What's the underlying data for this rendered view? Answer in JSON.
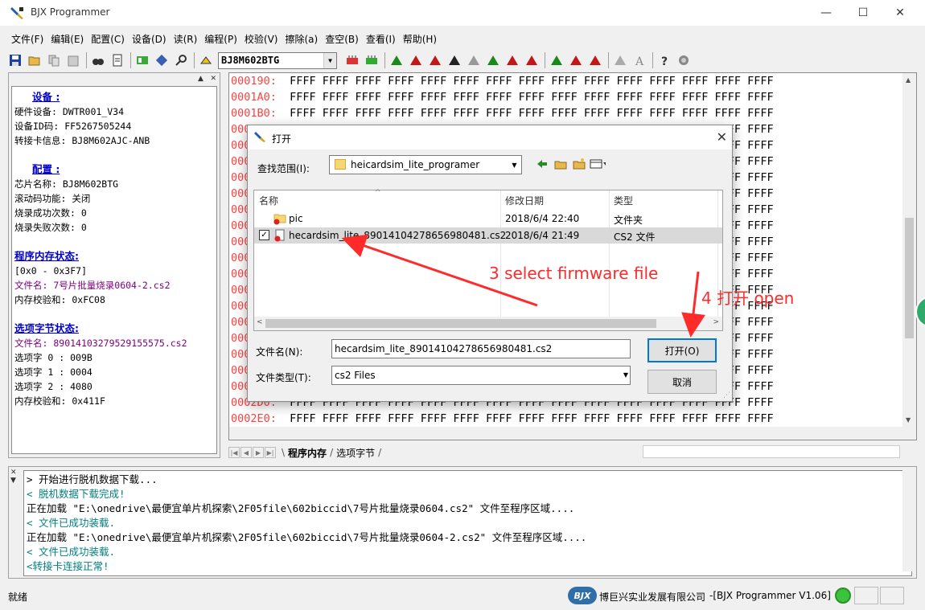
{
  "window": {
    "title": "BJX Programmer",
    "controls": {
      "minimize": "—",
      "maximize": "☐",
      "close": "✕"
    }
  },
  "menu": [
    "文件(F)",
    "编辑(E)",
    "配置(C)",
    "设备(D)",
    "读(R)",
    "编程(P)",
    "校验(V)",
    "擦除(a)",
    "查空(B)",
    "查看(I)",
    "帮助(H)"
  ],
  "toolbar": {
    "chip": "BJ8M602BTG"
  },
  "left_panel": {
    "device_section": "设备    :",
    "device_lines": [
      "硬件设备: DWTR001_V34",
      "设备ID码: FF5267505244",
      "转接卡信息: BJ8M602AJC-ANB"
    ],
    "config_section": "配置    :",
    "config_lines": [
      "芯片名称: BJ8M602BTG",
      "滚动码功能: 关闭",
      "烧录成功次数: 0",
      "烧录失败次数: 0"
    ],
    "memory_section": "程序内存状态:",
    "memory_range": "[0x0 - 0x3F7]",
    "memory_file": "文件名: 7号片批量烧录0604-2.cs2",
    "memory_checksum": "内存校验和: 0xFC08",
    "option_section": "选项字节状态:",
    "option_file": "文件名: 89014103279529155575.cs2",
    "option_lines": [
      "选项字 0 : 009B",
      "选项字 1 : 0004",
      "选项字 2 : 4080",
      "内存校验和: 0x411F"
    ]
  },
  "hex": {
    "rows": [
      {
        "addr": "000190:",
        "data": "FFFF FFFF FFFF FFFF FFFF FFFF FFFF FFFF FFFF FFFF FFFF FFFF FFFF FFFF FFFF"
      },
      {
        "addr": "0001A0:",
        "data": "FFFF FFFF FFFF FFFF FFFF FFFF FFFF FFFF FFFF FFFF FFFF FFFF FFFF FFFF FFFF"
      },
      {
        "addr": "0001B0:",
        "data": "FFFF FFFF FFFF FFFF FFFF FFFF FFFF FFFF FFFF FFFF FFFF FFFF FFFF FFFF FFFF"
      },
      {
        "addr": "0001C0:",
        "data": "FFFF FFFF FFFF FFFF FFFF FFFF FFFF FFFF FFFF FFFF FFFF FFFF FFFF FFFF FFFF"
      },
      {
        "addr": "0001D0:",
        "data": "FFFF FFFF FFFF FFFF FFFF FFFF FFFF FFFF FFFF FFFF FFFF FFFF FFFF FFFF FFFF"
      },
      {
        "addr": "0001E0:",
        "data": "FFFF FFFF FFFF FFFF FFFF FFFF FFFF FFFF FFFF FFFF FFFF FFFF FFFF FFFF FFFF"
      },
      {
        "addr": "0001F0:",
        "data": "FFFF FFFF FFFF FFFF FFFF FFFF FFFF FFFF FFFF FFFF FFFF FFFF FFFF FFFF FFFF"
      },
      {
        "addr": "000200:",
        "data": "FFFF FFFF FFFF FFFF FFFF FFFF FFFF FFFF FFFF FFFF FFFF FFFF FFFF FFFF FFFF"
      },
      {
        "addr": "000210:",
        "data": "FFFF FFFF FFFF FFFF FFFF FFFF FFFF FFFF FFFF FFFF FFFF FFFF FFFF FFFF FFFF"
      },
      {
        "addr": "000220:",
        "data": "FFFF FFFF FFFF FFFF FFFF FFFF FFFF FFFF FFFF FFFF FFFF FFFF FFFF FFFF FFFF"
      },
      {
        "addr": "000230:",
        "data": "FFFF FFFF FFFF FFFF FFFF FFFF FFFF FFFF FFFF FFFF FFFF FFFF FFFF FFFF FFFF"
      },
      {
        "addr": "000240:",
        "data": "FFFF FFFF FFFF FFFF FFFF FFFF FFFF FFFF FFFF FFFF FFFF FFFF FFFF FFFF FFFF"
      },
      {
        "addr": "000250:",
        "data": "FFFF FFFF FFFF FFFF FFFF FFFF FFFF FFFF FFFF FFFF FFFF FFFF FFFF FFFF FFFF"
      },
      {
        "addr": "000260:",
        "data": "FFFF FFFF FFFF FFFF FFFF FFFF FFFF FFFF FFFF FFFF FFFF FFFF FFFF FFFF FFFF"
      },
      {
        "addr": "000270:",
        "data": "FFFF FFFF FFFF FFFF FFFF FFFF FFFF FFFF FFFF FFFF FFFF FFFF FFFF FFFF FFFF"
      },
      {
        "addr": "000280:",
        "data": "FFFF FFFF FFFF FFFF FFFF FFFF FFFF FFFF FFFF FFFF FFFF FFFF FFFF FFFF FFFF"
      },
      {
        "addr": "000290:",
        "data": "FFFF FFFF FFFF FFFF FFFF FFFF FFFF FFFF FFFF FFFF FFFF FFFF FFFF FFFF FFFF"
      },
      {
        "addr": "0002A0:",
        "data": "FFFF FFFF FFFF FFFF FFFF FFFF FFFF FFFF FFFF FFFF FFFF FFFF FFFF FFFF FFFF"
      },
      {
        "addr": "0002B0:",
        "data": "FFFF FFFF FFFF FFFF FFFF FFFF FFFF FFFF FFFF FFFF FFFF FFFF FFFF FFFF FFFF"
      },
      {
        "addr": "0002C0:",
        "data": "FFFF FFFF FFFF FFFF FFFF FFFF FFFF FFFF FFFF FFFF FFFF FFFF FFFF FFFF FFFF"
      },
      {
        "addr": "0002D0:",
        "data": "FFFF FFFF FFFF FFFF FFFF FFFF FFFF FFFF FFFF FFFF FFFF FFFF FFFF FFFF FFFF"
      },
      {
        "addr": "0002E0:",
        "data": "FFFF FFFF FFFF FFFF FFFF FFFF FFFF FFFF FFFF FFFF FFFF FFFF FFFF FFFF FFFF"
      }
    ]
  },
  "sheet_tabs": [
    "程序内存",
    "选项字节"
  ],
  "log": [
    {
      "text": "> 开始进行脱机数据下载...",
      "kind": "normal"
    },
    {
      "text": "< 脱机数据下载完成!",
      "kind": "teal"
    },
    {
      "text": "正在加载 \"E:\\onedrive\\最便宜单片机探索\\2F05file\\602biccid\\7号片批量烧录0604.cs2\" 文件至程序区域....",
      "kind": "normal"
    },
    {
      "text": "< 文件已成功装载.",
      "kind": "teal"
    },
    {
      "text": "正在加载 \"E:\\onedrive\\最便宜单片机探索\\2F05file\\602biccid\\7号片批量烧录0604-2.cs2\" 文件至程序区域....",
      "kind": "normal"
    },
    {
      "text": "< 文件已成功装载.",
      "kind": "teal"
    },
    {
      "text": "<转接卡连接正常!",
      "kind": "teal"
    }
  ],
  "status": {
    "ready": "就绪",
    "logo": "BJX",
    "company": "博巨兴实业发展有限公司",
    "version": "-[BJX Programmer V1.06]"
  },
  "dialog": {
    "title": "打开",
    "look_in_label": "查找范围(I):",
    "look_in_value": "heicardsim_lite_programer",
    "columns": {
      "name": "名称",
      "date": "修改日期",
      "type": "类型"
    },
    "files": [
      {
        "name": "pic",
        "date": "2018/6/4 22:40",
        "type": "文件夹"
      },
      {
        "name": "hecardsim_lite_89014104278656980481.cs2",
        "date": "2018/6/4 21:49",
        "type": "CS2 文件"
      }
    ],
    "filename_label": "文件名(N):",
    "filename_value": "hecardsim_lite_89014104278656980481.cs2",
    "filetype_label": "文件类型(T):",
    "filetype_value": "cs2 Files",
    "open_button": "打开(O)",
    "cancel_button": "取消"
  },
  "annotations": {
    "step3": "3 select firmware file",
    "step4": "4 打开 open",
    "color": "#ff2a2a"
  }
}
